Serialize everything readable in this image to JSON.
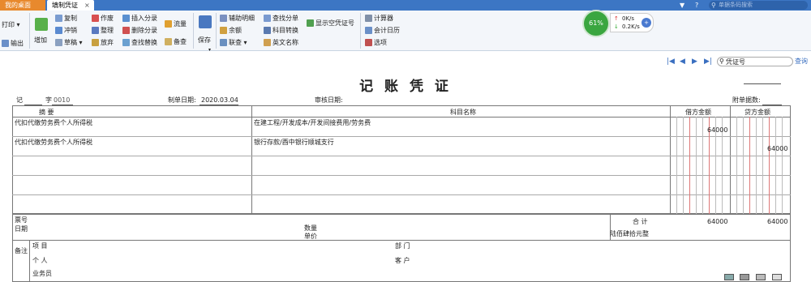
{
  "tabs": {
    "desktop": "我的桌面",
    "voucher": "填制凭证",
    "close": "×"
  },
  "titlebar_right": {
    "question": "?",
    "search_placeholder": "单据条码搜索"
  },
  "toolbar": {
    "print": "打印",
    "export": "输出",
    "add": "增加",
    "copy": "复制",
    "reverse": "冲销",
    "draft": "草稿",
    "void": "作废",
    "organize": "整理",
    "abandon": "放弃",
    "insert_entry": "插入分录",
    "delete_entry": "删除分录",
    "find_replace": "查找替换",
    "cashflow": "流量",
    "memo": "备查",
    "save": "保存",
    "aux_detail": "辅助明细",
    "balance": "余额",
    "link": "联查",
    "find_entry": "查找分单",
    "subject_convert": "科目转换",
    "english_name": "英文名称",
    "show_empty": "显示空凭证号",
    "calculator": "计算器",
    "calendar": "会计日历",
    "options": "选项"
  },
  "gauge": {
    "percent": "61%",
    "up": "0K/s",
    "down": "0.2K/s"
  },
  "nav": {
    "voucher_no_label": "凭证号",
    "query": "查询"
  },
  "voucher": {
    "title": "记 账 凭 证",
    "type": "记",
    "zi": "字",
    "number": "0010",
    "date_label": "制单日期:",
    "date": "2020.03.04",
    "audit_label": "审核日期:",
    "attach_label": "附单据数:",
    "col_summary": "摘 要",
    "col_subject": "科目名称",
    "col_debit": "借方金额",
    "col_credit": "贷方金额",
    "rows": [
      {
        "summary": "代扣代缴劳务费个人所得税",
        "subject": "在建工程/开发成本/开发间接费用/劳务费",
        "debit": "64000",
        "credit": ""
      },
      {
        "summary": "代扣代缴劳务费个人所得税",
        "subject": "银行存款/酉中银行顺城支行",
        "debit": "",
        "credit": "64000"
      }
    ],
    "bill_no": "票号",
    "bill_date": "日期",
    "quantity": "数量",
    "unit_price": "单价",
    "total_label": "合 计",
    "total_debit": "64000",
    "total_credit": "64000",
    "total_words": "陆佰肆拾元整",
    "memo": "备注",
    "project": "项 目",
    "person": "个 人",
    "salesman": "业务员",
    "department": "部 门",
    "customer": "客 户"
  },
  "colors": {
    "brand": "#3c76c4",
    "desktop_tab": "#e8892d",
    "gauge": "#3aa640"
  }
}
